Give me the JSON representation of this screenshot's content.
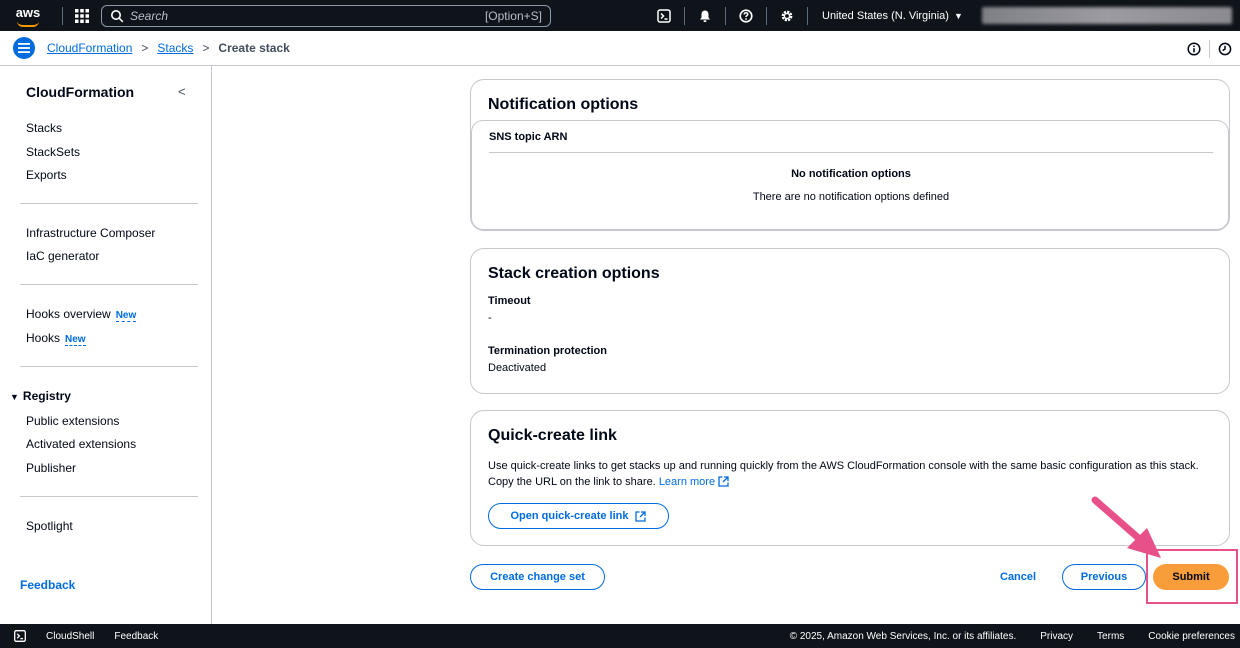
{
  "topnav": {
    "logo": "aws",
    "search_placeholder": "Search",
    "search_shortcut": "[Option+S]",
    "region": "United States (N. Virginia)",
    "icons": [
      "cloudshell-icon",
      "bell-icon",
      "help-icon",
      "gear-icon"
    ]
  },
  "breadcrumb": {
    "items": [
      "CloudFormation",
      "Stacks",
      "Create stack"
    ]
  },
  "sidebar": {
    "title": "CloudFormation",
    "group1": [
      "Stacks",
      "StackSets",
      "Exports"
    ],
    "group2": [
      "Infrastructure Composer",
      "IaC generator"
    ],
    "group3": [
      "Hooks overview",
      "Hooks"
    ],
    "new_badge": "New",
    "registry": {
      "title": "Registry",
      "items": [
        "Public extensions",
        "Activated extensions",
        "Publisher"
      ]
    },
    "group5": [
      "Spotlight"
    ],
    "feedback": "Feedback"
  },
  "notification": {
    "title": "Notification options",
    "column": "SNS topic ARN",
    "empty_title": "No notification options",
    "empty_desc": "There are no notification options defined"
  },
  "stack_options": {
    "title": "Stack creation options",
    "timeout_label": "Timeout",
    "timeout_value": "-",
    "termination_label": "Termination protection",
    "termination_value": "Deactivated"
  },
  "quick_create": {
    "title": "Quick-create link",
    "description": "Use quick-create links to get stacks up and running quickly from the AWS CloudFormation console with the same basic configuration as this stack. Copy the URL on the link to share.",
    "learn_more": "Learn more",
    "button": "Open quick-create link"
  },
  "actions": {
    "change_set": "Create change set",
    "cancel": "Cancel",
    "previous": "Previous",
    "submit": "Submit"
  },
  "footer": {
    "cloudshell": "CloudShell",
    "feedback": "Feedback",
    "copyright": "© 2025, Amazon Web Services, Inc. or its affiliates.",
    "privacy": "Privacy",
    "terms": "Terms",
    "cookies": "Cookie preferences"
  },
  "colors": {
    "link": "#006ce0",
    "primary_button": "#f89d39",
    "nav_bg": "#0f141a",
    "highlight": "#e8508a"
  }
}
